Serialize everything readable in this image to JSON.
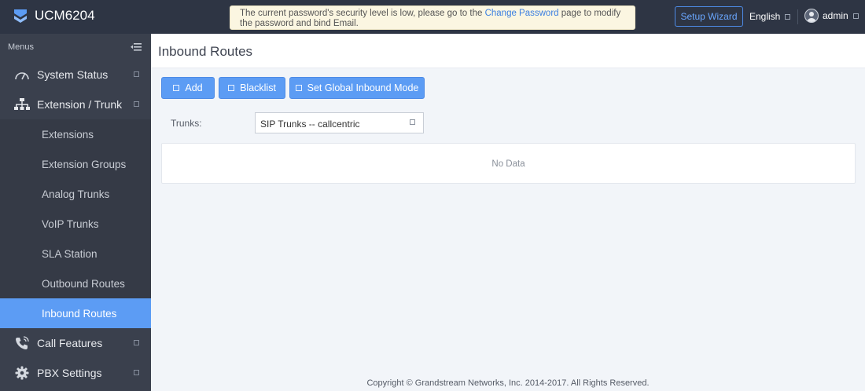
{
  "app": {
    "name": "UCM6204"
  },
  "notice": {
    "text_before": "The current password's security level is low, please go to the ",
    "link": "Change Password",
    "text_after": " page to modify the password and bind Email."
  },
  "header": {
    "setup_wizard": "Setup Wizard",
    "language": "English",
    "user": "admin"
  },
  "sidebar": {
    "title": "Menus",
    "items": [
      {
        "label": "System Status",
        "icon": "gauge-icon"
      },
      {
        "label": "Extension / Trunk",
        "icon": "network-icon",
        "expanded": true,
        "children": [
          {
            "label": "Extensions"
          },
          {
            "label": "Extension Groups"
          },
          {
            "label": "Analog Trunks"
          },
          {
            "label": "VoIP Trunks"
          },
          {
            "label": "SLA Station"
          },
          {
            "label": "Outbound Routes"
          },
          {
            "label": "Inbound Routes",
            "active": true
          }
        ]
      },
      {
        "label": "Call Features",
        "icon": "phone-icon"
      },
      {
        "label": "PBX Settings",
        "icon": "gear-icon"
      }
    ]
  },
  "main": {
    "title": "Inbound Routes",
    "buttons": {
      "add": "Add",
      "blacklist": "Blacklist",
      "global_mode": "Set Global Inbound Mode"
    },
    "trunks": {
      "label": "Trunks:",
      "selected": "SIP Trunks -- callcentric"
    },
    "table": {
      "empty_text": "No Data"
    }
  },
  "footer": {
    "copyright": "Copyright © Grandstream Networks, Inc. 2014-2017. All Rights Reserved."
  },
  "colors": {
    "topbar": "#2e3544",
    "sidebar": "#3a404d",
    "accent": "#5c9cf4",
    "notice_bg": "#fbf6e1"
  }
}
